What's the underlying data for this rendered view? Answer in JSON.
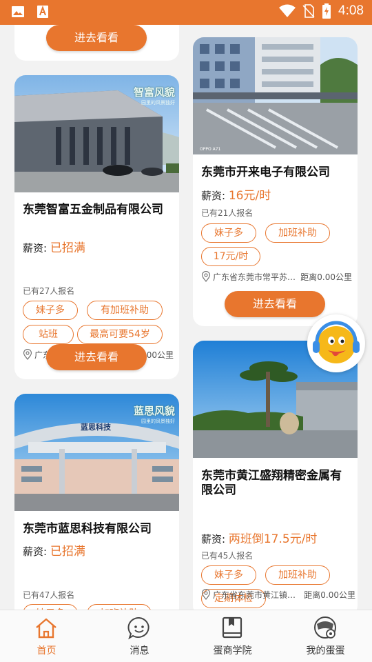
{
  "status_bar": {
    "time": "4:08"
  },
  "cards": [
    {
      "button": "进去看看"
    },
    {
      "watermark_title": "智富风貌",
      "watermark_sub": "园里的风景独好",
      "company": "东莞智富五金制品有限公司",
      "salary_label": "薪资:",
      "salary_value": "已招满",
      "signup": "已有27人报名",
      "tags": [
        "妹子多",
        "有加班补助",
        "站班",
        "最高可要54岁"
      ],
      "location": "广东省东莞市沙湖综…",
      "distance": "距离0.00公里",
      "button": "进去看看"
    },
    {
      "watermark_title": "蓝思风貌",
      "watermark_sub": "园里的风景独好",
      "sign_text": "蓝思科技",
      "company": "东莞市蓝思科技有限公司",
      "salary_label": "薪资:",
      "salary_value": "已招满",
      "signup": "已有47人报名",
      "tags": [
        "妹子多",
        "加班补助"
      ]
    },
    {
      "photo_text": "OPPO A71",
      "company": "东莞市开来电子有限公司",
      "salary_label": "薪资:",
      "salary_value": "16元/时",
      "signup": "已有21人报名",
      "tags": [
        "妹子多",
        "加班补助",
        "17元/时"
      ],
      "location": "广东省东莞市常平苏…",
      "distance": "距离0.00公里",
      "button": "进去看看"
    },
    {
      "company": "东莞市黄江盛翔精密金属有限公司",
      "salary_label": "薪资:",
      "salary_value": "两班倒17.5元/时",
      "signup": "已有45人报名",
      "tags": [
        "妹子多",
        "加班补助",
        "定期体检"
      ],
      "location": "广东省东莞市黄江镇…",
      "distance": "距离0.00公里"
    }
  ],
  "tabs": [
    {
      "label": "首页",
      "icon": "home-icon",
      "active": true
    },
    {
      "label": "消息",
      "icon": "message-icon",
      "active": false
    },
    {
      "label": "蛋商学院",
      "icon": "book-icon",
      "active": false
    },
    {
      "label": "我的蛋蛋",
      "icon": "profile-icon",
      "active": false
    }
  ],
  "colors": {
    "accent": "#e8762e",
    "status_bar": "#e8762e",
    "background": "#f2f2f2"
  }
}
